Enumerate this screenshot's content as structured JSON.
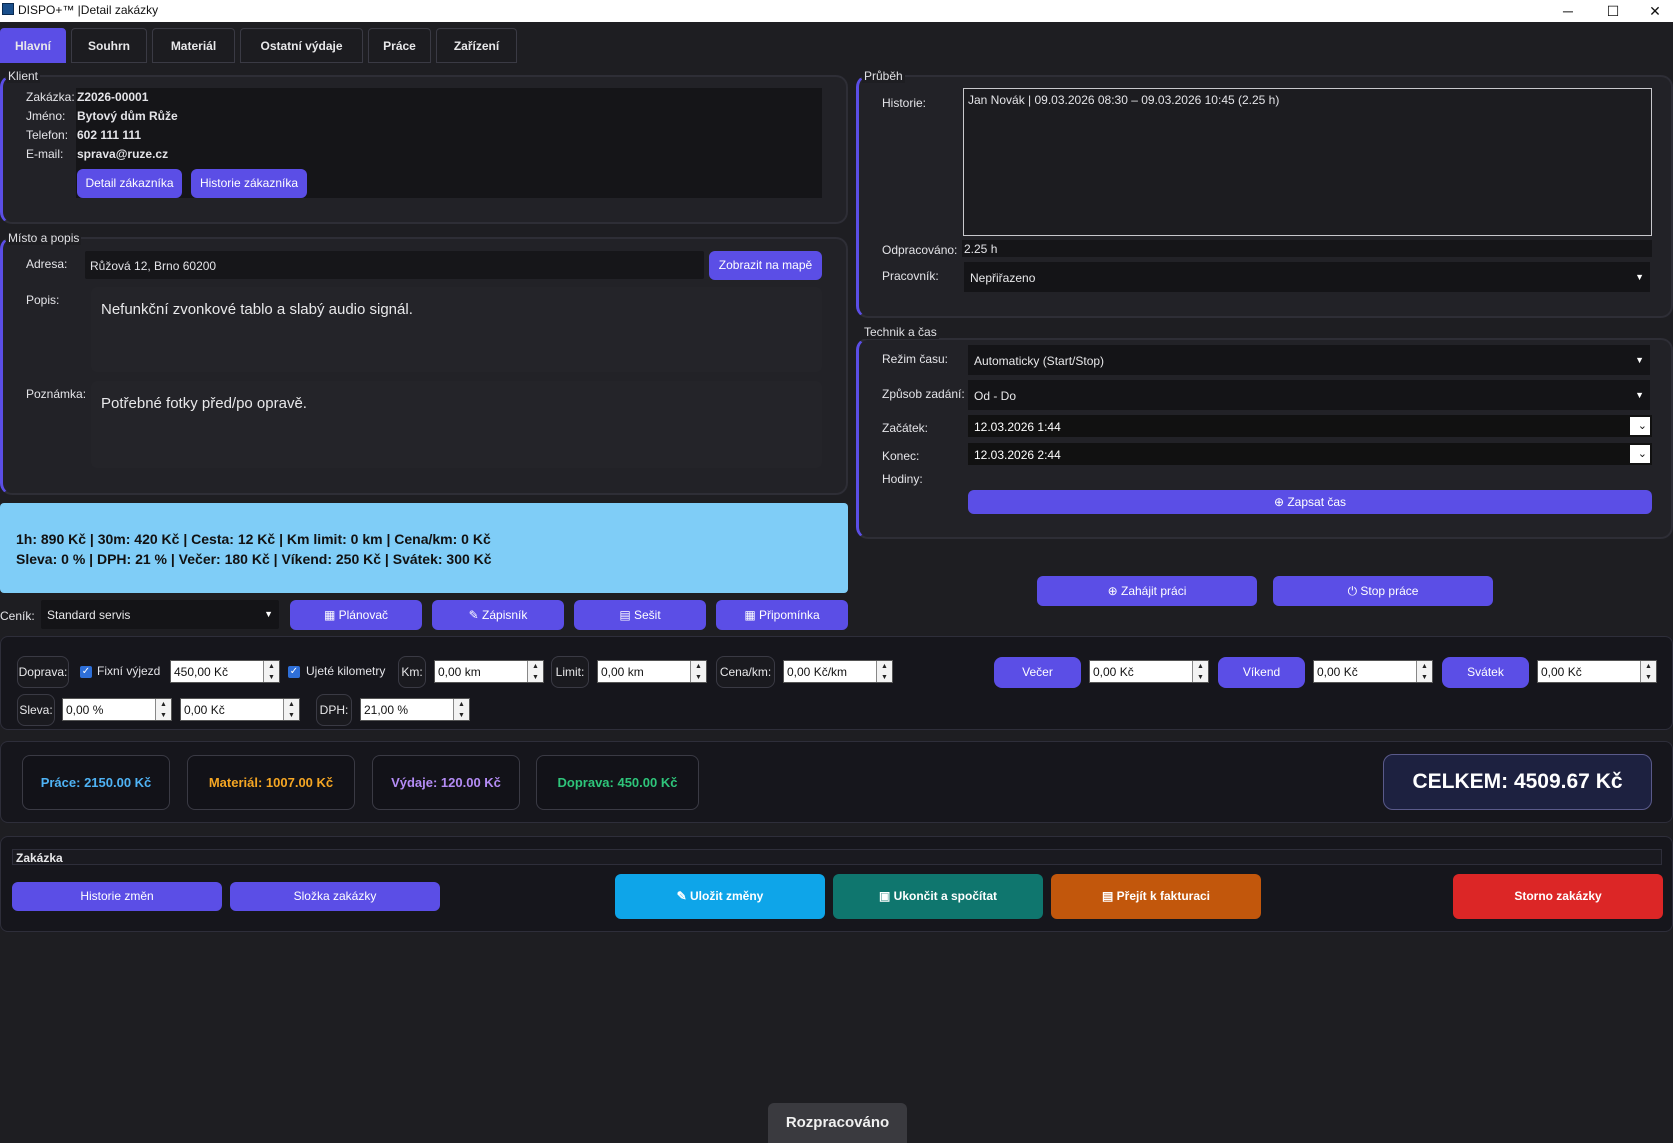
{
  "window": {
    "title": "DISPO+™ |Detail zakázky",
    "minimize": "─",
    "maximize": "☐",
    "close": "✕"
  },
  "tabs": [
    "Hlavní",
    "Souhrn",
    "Materiál",
    "Ostatní výdaje",
    "Práce",
    "Zařízení"
  ],
  "client": {
    "group_label": "Klient",
    "order_label": "Zakázka:",
    "order_value": "Z2026-00001",
    "name_label": "Jméno:",
    "name_value": "Bytový dům Růže",
    "phone_label": "Telefon:",
    "phone_value": "602 111 111",
    "email_label": "E-mail:",
    "email_value": "sprava@ruze.cz",
    "detail_button": "Detail zákazníka",
    "history_button": "Historie zákazníka"
  },
  "place": {
    "group_label": "Místo a popis",
    "address_label": "Adresa:",
    "address_value": "Růžová 12, Brno 60200",
    "map_button": "Zobrazit na mapě",
    "description_label": "Popis:",
    "description_value": "Nefunkční zvonkové tablo a slabý audio signál.",
    "note_label": "Poznámka:",
    "note_value": "Potřebné fotky před/po opravě."
  },
  "rates": {
    "line1": "1h: 890 Kč | 30m: 420 Kč | Cesta: 12 Kč | Km limit: 0 km | Cena/km: 0 Kč",
    "line2": "Sleva: 0 % | DPH: 21 % | Večer: 180 Kč | Víkend: 250 Kč | Svátek: 300 Kč",
    "bg_color": "#7fcdf7"
  },
  "pricelist": {
    "label": "Ceník:",
    "value": "Standard servis"
  },
  "actions": {
    "planner": "Plánovač",
    "notebook": "Zápisník",
    "workbook": "Sešit",
    "reminder": "Připomínka"
  },
  "progress": {
    "group_label": "Průběh",
    "history_label": "Historie:",
    "history_entry": "Jan Novák | 09.03.2026 08:30 – 09.03.2026 10:45 (2.25 h)",
    "worked_label": "Odpracováno:",
    "worked_value": "2.25 h",
    "worker_label": "Pracovník:",
    "worker_value": "Nepřiřazeno"
  },
  "tech": {
    "group_label": "Technik a čas",
    "mode_label": "Režim času:",
    "mode_value": "Automaticky (Start/Stop)",
    "entry_label": "Způsob zadání:",
    "entry_value": "Od - Do",
    "start_label": "Začátek:",
    "start_value": "12.03.2026 1:44",
    "end_label": "Konec:",
    "end_value": "12.03.2026 2:44",
    "hours_label": "Hodiny:",
    "record_button": "Zapsat čas"
  },
  "work": {
    "start_button": "Zahájit práci",
    "stop_button": "Stop práce"
  },
  "transport": {
    "label": "Doprava:",
    "fixed_label": "Fixní výjezd",
    "fixed_value": "450,00 Kč",
    "km_check_label": "Ujeté kilometry",
    "km_label": "Km:",
    "km_value": "0,00 km",
    "limit_label": "Limit:",
    "limit_value": "0,00 km",
    "price_km_label": "Cena/km:",
    "price_km_value": "0,00 Kč/km",
    "evening_button": "Večer",
    "evening_value": "0,00 Kč",
    "weekend_button": "Víkend",
    "weekend_value": "0,00 Kč",
    "holiday_button": "Svátek",
    "holiday_value": "0,00 Kč",
    "discount_label": "Sleva:",
    "discount_pct": "0,00 %",
    "discount_amount": "0,00 Kč",
    "vat_label": "DPH:",
    "vat_value": "21,00 %"
  },
  "summary": {
    "work": "Práce: 2150.00 Kč",
    "material": "Materiál: 1007.00 Kč",
    "expenses": "Výdaje: 120.00 Kč",
    "transport": "Doprava: 450.00 Kč",
    "total": "CELKEM: 4509.67 Kč",
    "colors": {
      "work": "#4fb3f5",
      "material": "#f5a623",
      "expenses": "#b48cf5",
      "transport": "#2ec47a"
    }
  },
  "order_bar": {
    "label": "Zakázka",
    "history_button": "Historie změn",
    "folder_button": "Složka zakázky",
    "save_button": "Uložit změny",
    "finish_button": "Ukončit a spočítat",
    "invoice_button": "Přejít k fakturaci",
    "cancel_button": "Storno zakázky"
  },
  "status": {
    "text": "Rozpracováno"
  }
}
